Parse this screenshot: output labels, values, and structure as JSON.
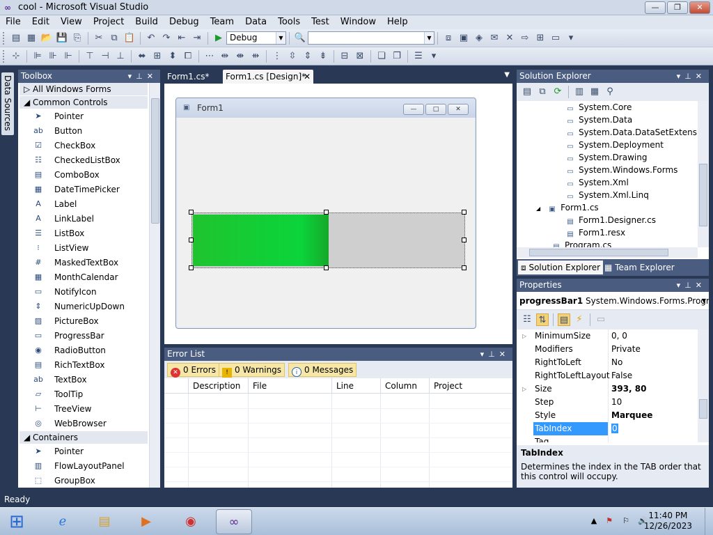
{
  "window": {
    "title": "cool - Microsoft Visual Studio",
    "icon": "vs-infinity-icon"
  },
  "menu": [
    "File",
    "Edit",
    "View",
    "Project",
    "Build",
    "Debug",
    "Team",
    "Data",
    "Tools",
    "Test",
    "Window",
    "Help"
  ],
  "toolbar": {
    "config": "Debug",
    "platform": ""
  },
  "side_rail": {
    "label": "Data Sources"
  },
  "toolbox": {
    "title": "Toolbox",
    "categories": {
      "all": "All Windows Forms",
      "common": "Common Controls",
      "containers": "Containers"
    },
    "common_items": [
      {
        "label": "Pointer",
        "icon": "pointer-icon"
      },
      {
        "label": "Button",
        "icon": "button-icon"
      },
      {
        "label": "CheckBox",
        "icon": "checkbox-icon"
      },
      {
        "label": "CheckedListBox",
        "icon": "checkedlistbox-icon"
      },
      {
        "label": "ComboBox",
        "icon": "combobox-icon"
      },
      {
        "label": "DateTimePicker",
        "icon": "datetimepicker-icon"
      },
      {
        "label": "Label",
        "icon": "label-icon"
      },
      {
        "label": "LinkLabel",
        "icon": "linklabel-icon"
      },
      {
        "label": "ListBox",
        "icon": "listbox-icon"
      },
      {
        "label": "ListView",
        "icon": "listview-icon"
      },
      {
        "label": "MaskedTextBox",
        "icon": "maskedtextbox-icon"
      },
      {
        "label": "MonthCalendar",
        "icon": "monthcalendar-icon"
      },
      {
        "label": "NotifyIcon",
        "icon": "notifyicon-icon"
      },
      {
        "label": "NumericUpDown",
        "icon": "numericupdown-icon"
      },
      {
        "label": "PictureBox",
        "icon": "picturebox-icon"
      },
      {
        "label": "ProgressBar",
        "icon": "progressbar-icon"
      },
      {
        "label": "RadioButton",
        "icon": "radiobutton-icon"
      },
      {
        "label": "RichTextBox",
        "icon": "richtextbox-icon"
      },
      {
        "label": "TextBox",
        "icon": "textbox-icon"
      },
      {
        "label": "ToolTip",
        "icon": "tooltip-icon"
      },
      {
        "label": "TreeView",
        "icon": "treeview-icon"
      },
      {
        "label": "WebBrowser",
        "icon": "webbrowser-icon"
      }
    ],
    "container_items": [
      {
        "label": "Pointer",
        "icon": "pointer-icon"
      },
      {
        "label": "FlowLayoutPanel",
        "icon": "flowlayoutpanel-icon"
      },
      {
        "label": "GroupBox",
        "icon": "groupbox-icon"
      }
    ]
  },
  "doc_tabs": {
    "tab1": "Form1.cs*",
    "tab2": "Form1.cs [Design]*"
  },
  "form": {
    "title": "Form1",
    "progress_fraction": 0.5,
    "fill_color": "#0bd43a"
  },
  "error_list": {
    "title": "Error List",
    "errors": "0 Errors",
    "warnings": "0 Warnings",
    "messages": "0 Messages",
    "columns": [
      "Description",
      "File",
      "Line",
      "Column",
      "Project"
    ]
  },
  "solution_explorer": {
    "title": "Solution Explorer",
    "nodes": [
      "System.Core",
      "System.Data",
      "System.Data.DataSetExtensions",
      "System.Deployment",
      "System.Drawing",
      "System.Windows.Forms",
      "System.Xml",
      "System.Xml.Linq"
    ],
    "form_file": "Form1.cs",
    "form_children": [
      "Form1.Designer.cs",
      "Form1.resx"
    ],
    "program": "Program.cs",
    "tab_solution": "Solution Explorer",
    "tab_team": "Team Explorer"
  },
  "properties": {
    "title": "Properties",
    "object_name": "progressBar1",
    "object_type": "System.Windows.Forms.Progress",
    "rows": [
      {
        "name": "MinimumSize",
        "value": "0, 0"
      },
      {
        "name": "Modifiers",
        "value": "Private"
      },
      {
        "name": "RightToLeft",
        "value": "No"
      },
      {
        "name": "RightToLeftLayout",
        "value": "False"
      },
      {
        "name": "Size",
        "value": "393, 80"
      },
      {
        "name": "Step",
        "value": "10"
      },
      {
        "name": "Style",
        "value": "Marquee"
      },
      {
        "name": "TabIndex",
        "value": "0"
      },
      {
        "name": "Tag",
        "value": ""
      }
    ],
    "desc_title": "TabIndex",
    "desc_text": "Determines the index in the TAB order that this control will occupy."
  },
  "status": {
    "text": "Ready"
  },
  "taskbar": {
    "time": "11:40 PM",
    "date": "12/26/2023"
  }
}
